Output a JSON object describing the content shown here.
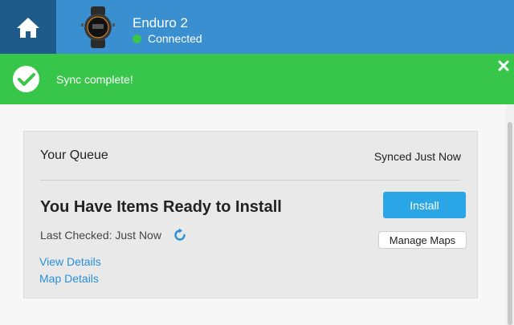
{
  "header": {
    "device_name": "Enduro 2",
    "status": "Connected",
    "status_color": "#3bc44b",
    "home_icon": "home-icon",
    "device_image": "watch-image"
  },
  "banner": {
    "message": "Sync complete!",
    "check_icon": "check-icon",
    "close_icon": "close-icon",
    "color": "#37c64a"
  },
  "queue": {
    "title": "Your Queue",
    "synced": "Synced Just Now",
    "heading": "You Have Items Ready to Install",
    "last_checked": "Last Checked: Just Now",
    "refresh_icon": "refresh-icon",
    "view_details": "View Details",
    "map_details": "Map Details",
    "install_label": "Install",
    "manage_maps_label": "Manage Maps"
  }
}
